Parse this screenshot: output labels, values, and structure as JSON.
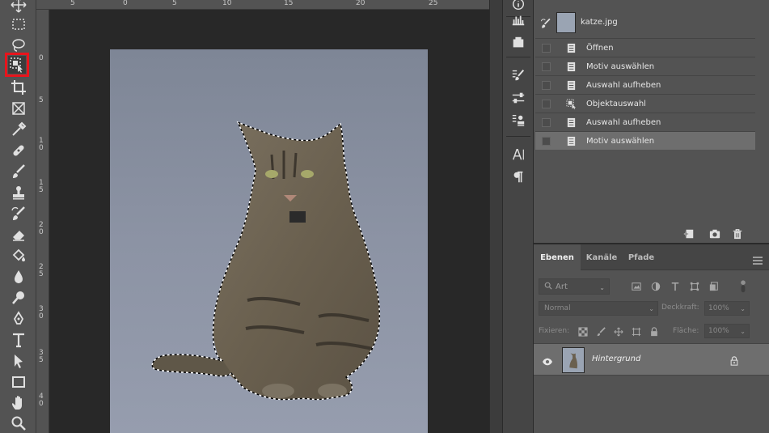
{
  "toolbar": {
    "tools": [
      {
        "name": "move-tool-icon"
      },
      {
        "name": "marquee-tool-icon"
      },
      {
        "name": "lasso-tool-icon"
      },
      {
        "name": "object-selection-tool-icon",
        "selected": true
      },
      {
        "name": "crop-tool-icon"
      },
      {
        "name": "frame-tool-icon"
      },
      {
        "name": "eyedropper-tool-icon"
      },
      {
        "name": "healing-brush-tool-icon"
      },
      {
        "name": "brush-tool-icon"
      },
      {
        "name": "clone-stamp-tool-icon"
      },
      {
        "name": "history-brush-tool-icon"
      },
      {
        "name": "eraser-tool-icon"
      },
      {
        "name": "paint-bucket-tool-icon"
      },
      {
        "name": "blur-tool-icon"
      },
      {
        "name": "dodge-tool-icon"
      },
      {
        "name": "pen-tool-icon"
      },
      {
        "name": "type-tool-icon"
      },
      {
        "name": "path-selection-tool-icon"
      },
      {
        "name": "rectangle-tool-icon"
      },
      {
        "name": "hand-tool-icon"
      },
      {
        "name": "zoom-tool-icon"
      }
    ],
    "highlight_color": "#e8141c"
  },
  "ruler": {
    "top": [
      "5",
      "0",
      "5",
      "10",
      "15",
      "20",
      "25"
    ],
    "left": [
      "0",
      "5",
      "1 0",
      "1 5",
      "2 0",
      "2 5",
      "3 0",
      "3 5",
      "4 0"
    ]
  },
  "history": {
    "document": "katze.jpg",
    "steps": [
      {
        "label": "Öffnen",
        "icon": "document-icon"
      },
      {
        "label": "Motiv auswählen",
        "icon": "document-icon"
      },
      {
        "label": "Auswahl aufheben",
        "icon": "document-icon"
      },
      {
        "label": "Objektauswahl",
        "icon": "object-selection-icon"
      },
      {
        "label": "Auswahl aufheben",
        "icon": "document-icon"
      },
      {
        "label": "Motiv auswählen",
        "icon": "document-icon",
        "active": true
      }
    ]
  },
  "layers": {
    "tabs": [
      "Ebenen",
      "Kanäle",
      "Pfade"
    ],
    "active_tab": "Ebenen",
    "kind_placeholder": "Art",
    "blend_mode": "Normal",
    "opacity_label": "Deckkraft:",
    "opacity_value": "100%",
    "lock_label": "Fixieren:",
    "fill_label": "Fläche:",
    "fill_value": "100%",
    "items": [
      {
        "name": "Hintergrund",
        "visible": true,
        "locked": true
      }
    ]
  },
  "colors": {
    "panel_bg": "#535353",
    "active_row": "#6e6e6e",
    "canvas_bg": "#282828"
  }
}
